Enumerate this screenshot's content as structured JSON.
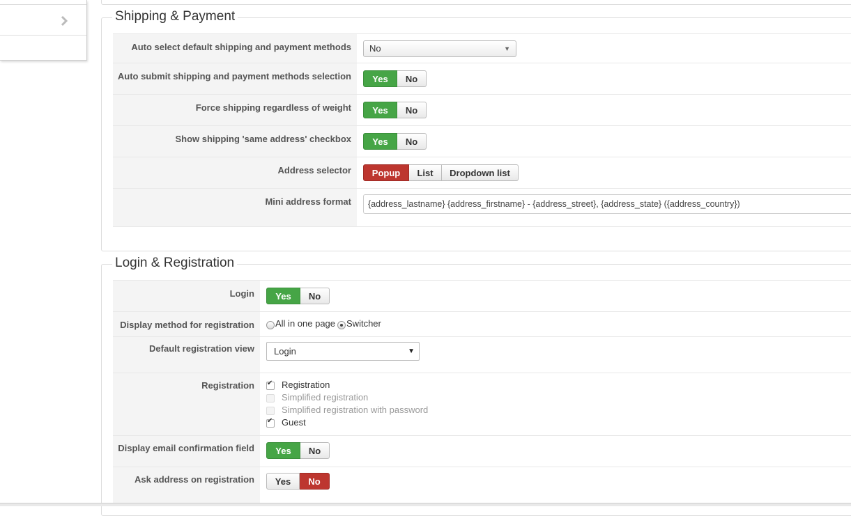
{
  "sidebar": {
    "items": [
      {
        "icon": "chevron-right-icon"
      },
      {
        "icon": "chevron-right-icon"
      }
    ]
  },
  "shipping": {
    "title": "Shipping & Payment",
    "auto_select": {
      "label": "Auto select default shipping and payment methods",
      "value": "No"
    },
    "auto_submit": {
      "label": "Auto submit shipping and payment methods selection",
      "yes": "Yes",
      "no": "No",
      "selected": "Yes"
    },
    "force_shipping": {
      "label": "Force shipping regardless of weight",
      "yes": "Yes",
      "no": "No",
      "selected": "Yes"
    },
    "same_address": {
      "label": "Show shipping 'same address' checkbox",
      "yes": "Yes",
      "no": "No",
      "selected": "Yes"
    },
    "address_selector": {
      "label": "Address selector",
      "options": [
        "Popup",
        "List",
        "Dropdown list"
      ],
      "selected": "Popup"
    },
    "mini_address": {
      "label": "Mini address format",
      "value": "{address_lastname} {address_firstname} - {address_street}, {address_state} ({address_country})"
    }
  },
  "login": {
    "title": "Login & Registration",
    "login": {
      "label": "Login",
      "yes": "Yes",
      "no": "No",
      "selected": "Yes"
    },
    "display_method": {
      "label": "Display method for registration",
      "options": [
        "All in one page",
        "Switcher"
      ],
      "selected": "Switcher"
    },
    "default_view": {
      "label": "Default registration view",
      "value": "Login"
    },
    "registration": {
      "label": "Registration",
      "options": [
        {
          "text": "Registration",
          "checked": true,
          "disabled": false
        },
        {
          "text": "Simplified registration",
          "checked": false,
          "disabled": true
        },
        {
          "text": "Simplified registration with password",
          "checked": false,
          "disabled": true
        },
        {
          "text": "Guest",
          "checked": true,
          "disabled": false
        }
      ]
    },
    "email_confirm": {
      "label": "Display email confirmation field",
      "yes": "Yes",
      "no": "No",
      "selected": "Yes"
    },
    "ask_address": {
      "label": "Ask address on registration",
      "yes": "Yes",
      "no": "No",
      "selected": "No"
    }
  },
  "colors": {
    "green": "#46a546",
    "red": "#bd362f"
  }
}
